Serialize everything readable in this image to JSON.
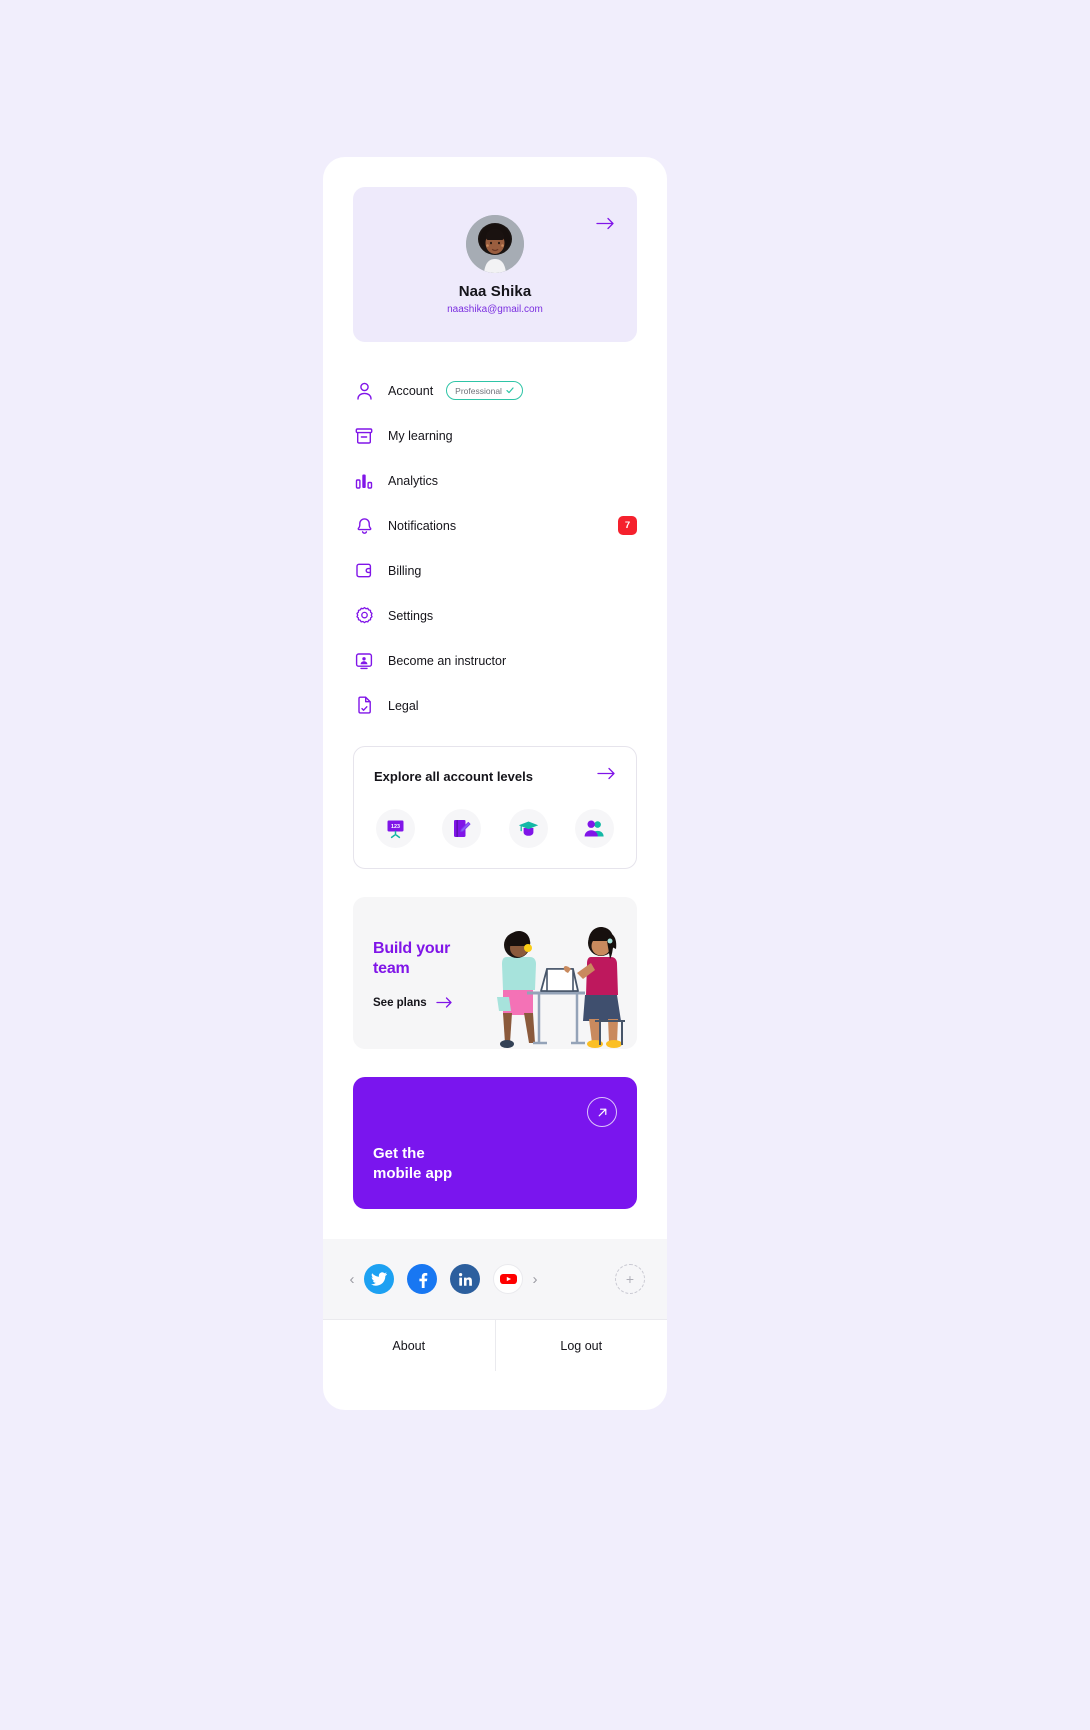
{
  "profile": {
    "name": "Naa Shika",
    "email": "naashika@gmail.com",
    "arrow_icon": "arrow-right-icon",
    "avatar_alt": "user-avatar"
  },
  "menu": {
    "items": [
      {
        "label": "Account",
        "icon": "person-icon",
        "badge_text": "Professional",
        "badge_check": "✓"
      },
      {
        "label": "My learning",
        "icon": "archive-box-icon"
      },
      {
        "label": "Analytics",
        "icon": "bar-chart-icon"
      },
      {
        "label": "Notifications",
        "icon": "bell-icon",
        "count": "7"
      },
      {
        "label": "Billing",
        "icon": "wallet-icon"
      },
      {
        "label": "Settings",
        "icon": "gear-icon"
      },
      {
        "label": "Become an instructor",
        "icon": "instructor-screen-icon"
      },
      {
        "label": "Legal",
        "icon": "document-check-icon"
      }
    ]
  },
  "explore": {
    "title": "Explore all account levels",
    "arrow_icon": "arrow-right-icon",
    "chips": [
      {
        "name": "whiteboard-123-icon",
        "label": "123"
      },
      {
        "name": "notebook-pencil-icon"
      },
      {
        "name": "graduation-cap-icon"
      },
      {
        "name": "people-group-icon"
      }
    ]
  },
  "team": {
    "title": "Build your\nteam",
    "title_line1": "Build your",
    "title_line2": "team",
    "link_label": "See plans",
    "link_arrow": "arrow-right-icon",
    "illustration": "two-women-at-desk-illustration"
  },
  "app_banner": {
    "title_line1": "Get the",
    "title_line2": "mobile app",
    "arrow_icon": "arrow-up-right-icon",
    "color": "#7A15EE"
  },
  "social": {
    "prev_icon": "chevron-left-icon",
    "next_icon": "chevron-right-icon",
    "add_icon": "plus-icon",
    "items": [
      {
        "name": "twitter-icon",
        "color": "#1DA1F2"
      },
      {
        "name": "facebook-icon",
        "color": "#1877F2"
      },
      {
        "name": "linkedin-icon",
        "color": "#2C5F9E"
      },
      {
        "name": "youtube-icon",
        "color": "#FF0000"
      }
    ]
  },
  "footer": {
    "about_label": "About",
    "logout_label": "Log out"
  },
  "colors": {
    "page_bg": "#F1EEFC",
    "accent_purple": "#7B2FE0",
    "icon_purple": "#8015E8",
    "badge_red": "#F5212D",
    "badge_teal": "#2EC4A6"
  }
}
